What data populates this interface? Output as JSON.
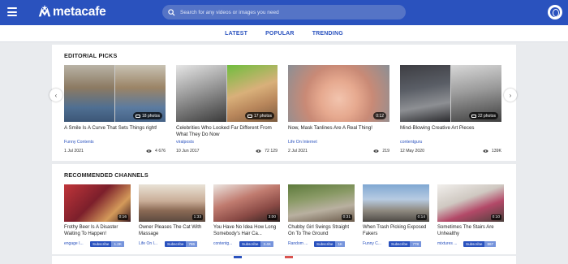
{
  "header": {
    "logo_text": "metacafe",
    "search_placeholder": "Search for any videos or images you need"
  },
  "tabs": [
    {
      "label": "LATEST"
    },
    {
      "label": "POPULAR"
    },
    {
      "label": "TRENDING"
    }
  ],
  "editorial": {
    "title": "EDITORIAL PICKS",
    "items": [
      {
        "title": "A Smile Is A Curve That Sets Things right!",
        "badge": "18 photos",
        "source": "Funny Contents",
        "date": "1 Jul 2021",
        "views": "4 676"
      },
      {
        "title": "Celebrities Who Looked Far Different From What They Do Now",
        "badge": "17 photos",
        "source": "viralposts",
        "date": "10 Jun 2017",
        "views": "72 129"
      },
      {
        "title": "Now, Mask Tanlines Are A Real Thing!",
        "badge": "0:12",
        "source": "Life On Internet",
        "date": "2 Jul 2021",
        "views": "219"
      },
      {
        "title": "Mind-Blowing Creative Art Pieces",
        "badge": "22 photos",
        "source": "contentguru",
        "date": "12 May 2020",
        "views": "139K"
      }
    ]
  },
  "channels": {
    "title": "RECOMMENDED CHANNELS",
    "subscribe_label": "Subscribe",
    "items": [
      {
        "title": "Frothy Beer Is A Disaster Waiting To Happen!",
        "duration": "0:16",
        "channel": "engage I...",
        "subs": "1.2K"
      },
      {
        "title": "Owner Pleases The Cat With Massage",
        "duration": "1:33",
        "channel": "Life On I...",
        "subs": "786"
      },
      {
        "title": "You Have No Idea How Long Somebody's Hair Ca...",
        "duration": "3:00",
        "channel": "contentg...",
        "subs": "3.4K"
      },
      {
        "title": "Chubby Girl Swings Straight On To The Ground",
        "duration": "0:31",
        "channel": "Random ...",
        "subs": "1K"
      },
      {
        "title": "When Trash Picking Exposed Fakers",
        "duration": "0:14",
        "channel": "Funny C...",
        "subs": "778"
      },
      {
        "title": "Sometimes The Stairs Are Unhealthy",
        "duration": "0:10",
        "channel": "mixtures ...",
        "subs": "867"
      }
    ]
  },
  "icons": {
    "menu": "menu-icon",
    "logo": "metacafe-logo-icon",
    "search": "search-icon",
    "user": "user-icon",
    "camera": "camera-icon",
    "views": "eye-icon",
    "prev": "chevron-left-icon",
    "next": "chevron-right-icon"
  },
  "colors": {
    "brand": "#2a52be",
    "search_bg": "#5574c6",
    "page_bg": "#e9ebee"
  }
}
